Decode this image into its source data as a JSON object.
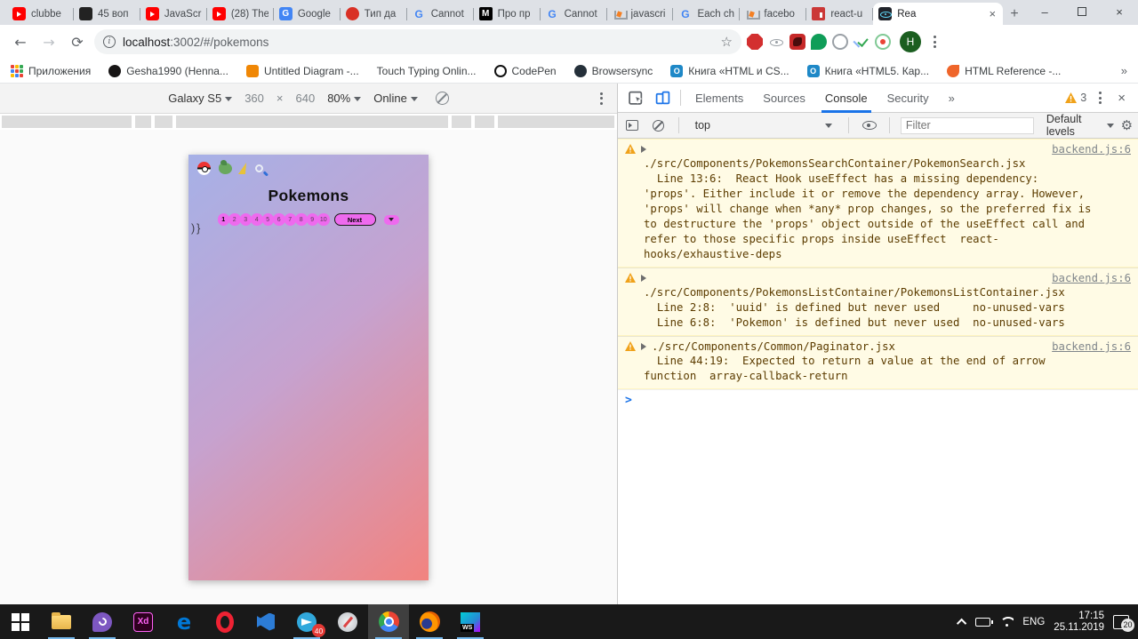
{
  "browser": {
    "tabs": [
      {
        "title": "clubbe"
      },
      {
        "title": "45 воп"
      },
      {
        "title": "JavaScr"
      },
      {
        "title": "(28) The"
      },
      {
        "title": "Google"
      },
      {
        "title": "Тип да"
      },
      {
        "title": "Cannot"
      },
      {
        "title": "Про пр"
      },
      {
        "title": "Cannot"
      },
      {
        "title": "javascri"
      },
      {
        "title": "Each ch"
      },
      {
        "title": "facebo"
      },
      {
        "title": "react-u"
      },
      {
        "title": "Rea"
      }
    ],
    "new_tab_label": "+",
    "controls": {
      "minimize": "–",
      "close": "×"
    }
  },
  "glyphs": {
    "back": "←",
    "forward": "→",
    "reload": "⟳",
    "star": "☆",
    "info": "i",
    "overflow": "»",
    "gear": "⚙",
    "tab_close": "×",
    "close": "×",
    "profile_initial": "H",
    "medium": "M",
    "g_letter": "G",
    "book_o": "O"
  },
  "nav": {
    "url_host": "localhost",
    "url_rest": ":3002/#/pokemons"
  },
  "bookmarks": {
    "items": [
      {
        "label": "Приложения"
      },
      {
        "label": "Gesha1990 (Henna..."
      },
      {
        "label": "Untitled Diagram -..."
      },
      {
        "label": "Touch Typing Onlin..."
      },
      {
        "label": "CodePen"
      },
      {
        "label": "Browsersync"
      },
      {
        "label": "Книга «HTML и CS..."
      },
      {
        "label": "Книга «HTML5. Кар..."
      },
      {
        "label": "HTML Reference -..."
      }
    ],
    "overflow": "»"
  },
  "device_toolbar": {
    "device": "Galaxy S5",
    "width": "360",
    "sep": "×",
    "height": "640",
    "zoom": "80%",
    "network": "Online"
  },
  "app": {
    "title": "Pokemons",
    "pages": [
      "1",
      "2",
      "3",
      "4",
      "5",
      "6",
      "7",
      "8",
      "9",
      "10"
    ],
    "next_label": "Next",
    "stray_text": ")}"
  },
  "devtools": {
    "tabs": [
      {
        "label": "Elements"
      },
      {
        "label": "Sources"
      },
      {
        "label": "Console"
      },
      {
        "label": "Security"
      }
    ],
    "more_tabs": "»",
    "warning_count": "3",
    "console": {
      "context": "top",
      "filter_placeholder": "Filter",
      "levels": "Default levels",
      "prompt": ">",
      "messages": [
        {
          "head": "",
          "source": "backend.js:6",
          "body": "./src/Components/PokemonsSearchContainer/PokemonSearch.jsx\n  Line 13:6:  React Hook useEffect has a missing dependency:\n'props'. Either include it or remove the dependency array. However,\n'props' will change when *any* prop changes, so the preferred fix is\nto destructure the 'props' object outside of the useEffect call and\nrefer to those specific props inside useEffect  react-\nhooks/exhaustive-deps"
        },
        {
          "head": "",
          "source": "backend.js:6",
          "body": "./src/Components/PokemonsListContainer/PokemonsListContainer.jsx\n  Line 2:8:  'uuid' is defined but never used     no-unused-vars\n  Line 6:8:  'Pokemon' is defined but never used  no-unused-vars"
        },
        {
          "head": "./src/Components/Common/Paginator.jsx",
          "source": "backend.js:6",
          "body": "  Line 44:19:  Expected to return a value at the end of arrow\nfunction  array-callback-return"
        }
      ]
    }
  },
  "taskbar": {
    "telegram_badge": "40",
    "webstorm_label": "WS",
    "xd_label": "Xd",
    "edge_label": "e",
    "tray": {
      "lang": "ENG",
      "time": "17:15",
      "date": "25.11.2019",
      "notif_count": "20"
    }
  }
}
